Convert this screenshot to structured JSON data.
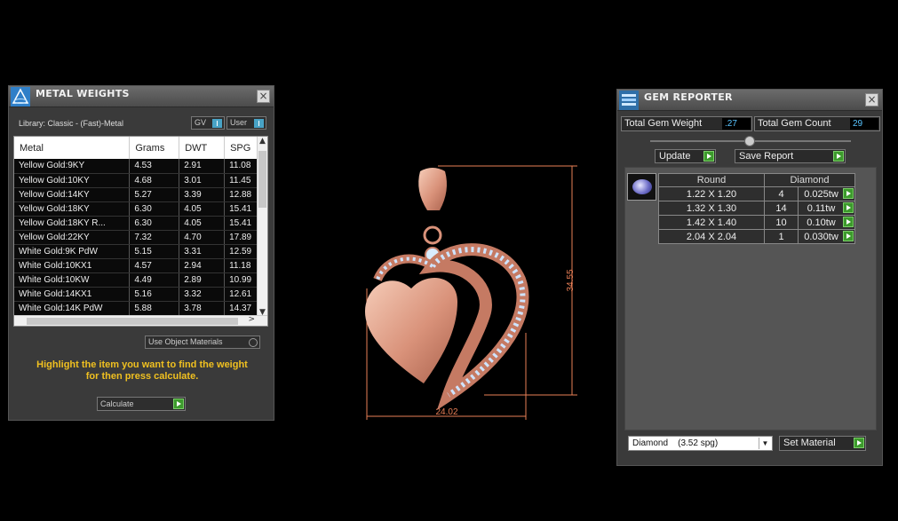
{
  "metal_weights": {
    "title": "METAL WEIGHTS",
    "library_label": "Library: Classic - (Fast)-Metal",
    "toggles": [
      {
        "label": "GV"
      },
      {
        "label": "User"
      }
    ],
    "columns": [
      "Metal",
      "Grams",
      "DWT",
      "SPG"
    ],
    "rows": [
      [
        "Yellow Gold:9KY",
        "4.53",
        "2.91",
        "11.08"
      ],
      [
        "Yellow Gold:10KY",
        "4.68",
        "3.01",
        "11.45"
      ],
      [
        "Yellow Gold:14KY",
        "5.27",
        "3.39",
        "12.88"
      ],
      [
        "Yellow Gold:18KY",
        "6.30",
        "4.05",
        "15.41"
      ],
      [
        "Yellow Gold:18KY R...",
        "6.30",
        "4.05",
        "15.41"
      ],
      [
        "Yellow Gold:22KY",
        "7.32",
        "4.70",
        "17.89"
      ],
      [
        "White Gold:9K PdW",
        "5.15",
        "3.31",
        "12.59"
      ],
      [
        "White Gold:10KX1",
        "4.57",
        "2.94",
        "11.18"
      ],
      [
        "White Gold:10KW",
        "4.49",
        "2.89",
        "10.99"
      ],
      [
        "White Gold:14KX1",
        "5.16",
        "3.32",
        "12.61"
      ],
      [
        "White Gold:14K PdW",
        "5.88",
        "3.78",
        "14.37"
      ]
    ],
    "use_object_materials": "Use Object Materials",
    "hint_line1": "Highlight the item you want to find the weight",
    "hint_line2": "for then press calculate.",
    "calculate_label": "Calculate"
  },
  "viewport": {
    "height_dim": "34.55",
    "width_dim": "24.02",
    "metal_color": "#e2a38c",
    "dim_color": "#e97f56"
  },
  "gem_reporter": {
    "title": "GEM REPORTER",
    "total_weight_label": "Total Gem Weight",
    "total_weight_value": ".27",
    "total_count_label": "Total Gem Count",
    "total_count_value": "29",
    "update_label": "Update",
    "save_report_label": "Save Report",
    "columns": [
      "Round",
      "Diamond"
    ],
    "rows": [
      [
        "1.22 X 1.20",
        "4",
        "0.025tw"
      ],
      [
        "1.32 X 1.30",
        "14",
        "0.11tw"
      ],
      [
        "1.42 X 1.40",
        "10",
        "0.10tw"
      ],
      [
        "2.04 X 2.04",
        "1",
        "0.030tw"
      ]
    ],
    "material_select": "Diamond    (3.52 spg)",
    "set_material_label": "Set Material"
  }
}
